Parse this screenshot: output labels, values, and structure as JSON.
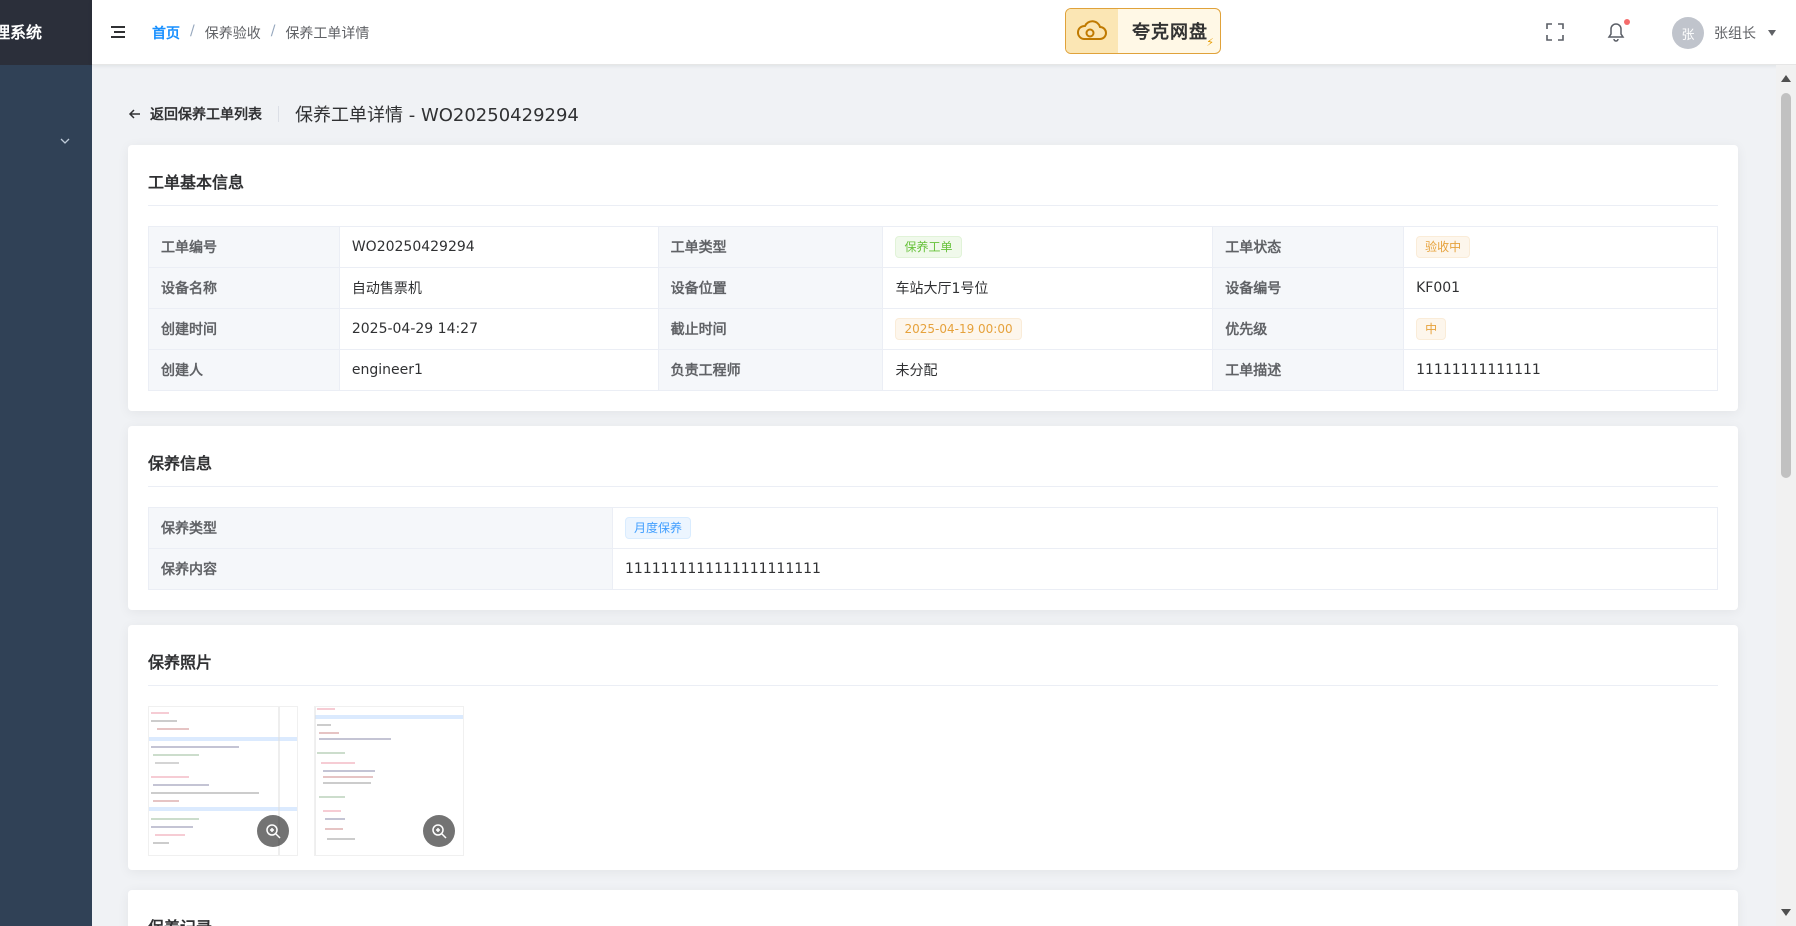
{
  "sidebar": {
    "brand": "理系统"
  },
  "header": {
    "breadcrumb": [
      "首页",
      "保养验收",
      "保养工单详情"
    ],
    "quark_label": "夸克网盘",
    "user_name": "张组长",
    "avatar_text": "张"
  },
  "page": {
    "back_label": "返回保养工单列表",
    "title": "保养工单详情 - WO20250429294"
  },
  "basic_info": {
    "title": "工单基本信息",
    "rows": [
      [
        {
          "label": "工单编号",
          "value": "WO20250429294"
        },
        {
          "label": "工单类型",
          "value": "保养工单",
          "tag": "green"
        },
        {
          "label": "工单状态",
          "value": "验收中",
          "tag": "orange"
        }
      ],
      [
        {
          "label": "设备名称",
          "value": "自动售票机"
        },
        {
          "label": "设备位置",
          "value": "车站大厅1号位"
        },
        {
          "label": "设备编号",
          "value": "KF001"
        }
      ],
      [
        {
          "label": "创建时间",
          "value": "2025-04-29 14:27"
        },
        {
          "label": "截止时间",
          "value": "2025-04-19 00:00",
          "tag": "orange"
        },
        {
          "label": "优先级",
          "value": "中",
          "tag": "orange"
        }
      ],
      [
        {
          "label": "创建人",
          "value": "engineer1"
        },
        {
          "label": "负责工程师",
          "value": "未分配"
        },
        {
          "label": "工单描述",
          "value": "11111111111111"
        }
      ]
    ]
  },
  "maintenance_info": {
    "title": "保养信息",
    "type_label": "保养类型",
    "type_value": "月度保养",
    "content_label": "保养内容",
    "content_value": "1111111111111111111111"
  },
  "photos": {
    "title": "保养照片",
    "count": 2
  },
  "records": {
    "title": "保养记录"
  },
  "colors": {
    "sidebar": "#304156",
    "accent": "#1890ff",
    "tag_green": "#67c23a",
    "tag_orange": "#e6a23c",
    "tag_blue": "#409eff"
  }
}
